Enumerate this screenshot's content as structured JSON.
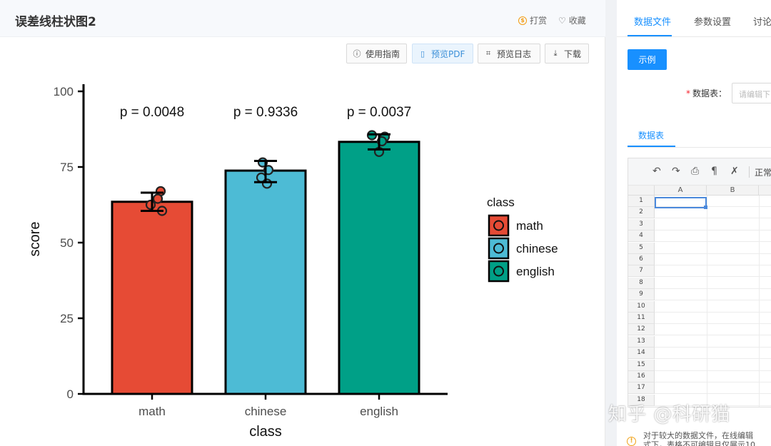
{
  "panel": {
    "title": "误差线柱状图2",
    "reward_label": "打赏",
    "favorite_label": "收藏",
    "toolbar": {
      "guide_label": "使用指南",
      "preview_pdf_label": "预览PDF",
      "preview_log_label": "预览日志",
      "download_label": "下载"
    }
  },
  "chart_data": {
    "type": "bar",
    "xlabel": "class",
    "ylabel": "score",
    "ylim": [
      0,
      100
    ],
    "yticks": [
      0,
      25,
      50,
      75,
      100
    ],
    "categories": [
      "math",
      "chinese",
      "english"
    ],
    "values": [
      63.5,
      73.8,
      83.3
    ],
    "error_low": [
      60.5,
      70.0,
      80.8
    ],
    "error_high": [
      66.5,
      77.0,
      85.8
    ],
    "points": [
      [
        67,
        64.5,
        62.5,
        60.5
      ],
      [
        76.5,
        74,
        71.5,
        69.5
      ],
      [
        85.5,
        85,
        83.5,
        80
      ]
    ],
    "pvalues": [
      "p = 0.0048",
      "p = 0.9336",
      "p = 0.0037"
    ],
    "colors": [
      "#e64b35",
      "#4dbbd5",
      "#00a087"
    ],
    "legend_title": "class",
    "legend_position": "right",
    "grid": false
  },
  "sidebar": {
    "tabs": [
      "数据文件",
      "参数设置",
      "讨论"
    ],
    "example_label": "示例",
    "table_label": "数据表：",
    "table_placeholder": "请编辑下",
    "subtab_label": "数据表",
    "sheet": {
      "zoom_label": "正常",
      "columns": [
        "A",
        "B"
      ],
      "rows": [
        "1",
        "2",
        "3",
        "4",
        "5",
        "6",
        "7",
        "8",
        "9",
        "10",
        "11",
        "12",
        "13",
        "14",
        "15",
        "16",
        "17",
        "18"
      ]
    },
    "info_text_line1": "对于较大的数据文件，在线编辑",
    "info_text_line2": "式下，表格不可编辑且仅展示10"
  },
  "watermark": "知乎 @科研猫",
  "colors": {
    "accent": "#1890ff",
    "header_bg": "#f7f9fc",
    "math": "#e64b35",
    "chinese": "#4dbbd5",
    "english": "#00a087"
  }
}
